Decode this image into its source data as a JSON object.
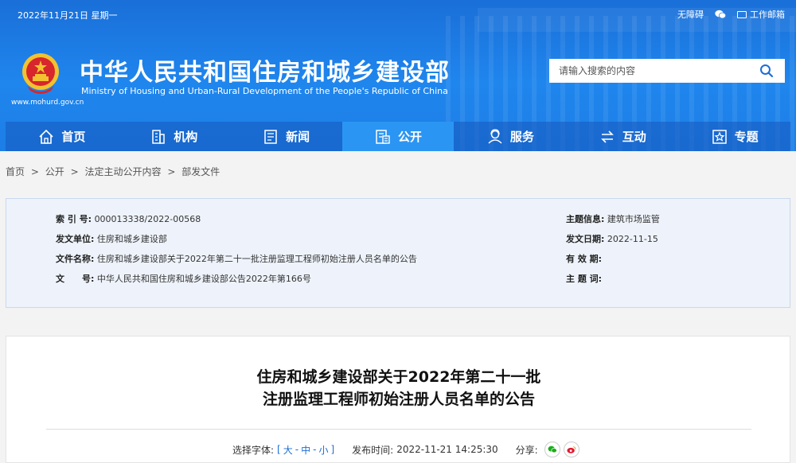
{
  "top": {
    "date": "2022年11月21日 星期一",
    "accessibility": "无障碍",
    "wechat_icon": "wechat-icon",
    "mail_label": "工作邮箱"
  },
  "brand": {
    "url": "www.mohurd.gov.cn",
    "title_cn": "中华人民共和国住房和城乡建设部",
    "title_en": "Ministry of Housing and Urban-Rural Development of the People's Republic of China",
    "emblem_colors": {
      "red": "#d7262c",
      "gold": "#f2c230"
    }
  },
  "search": {
    "placeholder": "请输入搜索的内容",
    "icon": "search-icon"
  },
  "nav": {
    "items": [
      {
        "label": "首页",
        "icon": "home-icon"
      },
      {
        "label": "机构",
        "icon": "building-icon"
      },
      {
        "label": "新闻",
        "icon": "news-icon"
      },
      {
        "label": "公开",
        "icon": "document-icon"
      },
      {
        "label": "服务",
        "icon": "service-icon"
      },
      {
        "label": "互动",
        "icon": "exchange-icon"
      },
      {
        "label": "专题",
        "icon": "star-icon"
      }
    ],
    "active": "公开",
    "active_color": "#2b95f3"
  },
  "breadcrumb": [
    "首页",
    ">",
    "公开",
    ">",
    "法定主动公开内容",
    ">",
    "部发文件"
  ],
  "meta": {
    "index_label": "索 引 号:",
    "index_value": "000013338/2022-00568",
    "topic_label": "主题信息:",
    "topic_value": "建筑市场监管",
    "issuer_label": "发文单位:",
    "issuer_value": "住房和城乡建设部",
    "date_label": "发文日期:",
    "date_value": "2022-11-15",
    "name_label": "文件名称:",
    "name_value": "住房和城乡建设部关于2022年第二十一批注册监理工程师初始注册人员名单的公告",
    "valid_label": "有 效 期:",
    "doc_label": "文　　号:",
    "doc_value": "中华人民共和国住房和城乡建设部公告2022年第166号",
    "keyword_label": "主 题 词:"
  },
  "article": {
    "title_line1": "住房和城乡建设部关于2022年第二十一批",
    "title_line2": "注册监理工程师初始注册人员名单的公告",
    "font_label": "选择字体:",
    "bracket_open": "[",
    "font_large": "大",
    "sep1": "-",
    "font_medium": "中",
    "sep2": "-",
    "font_small": "小",
    "bracket_close": "]",
    "publish_label": "发布时间:",
    "publish_value": "2022-11-21 14:25:30",
    "share_label": "分享:",
    "share_wechat_color": "#1aad19",
    "share_weibo_color": "#e6162d"
  }
}
